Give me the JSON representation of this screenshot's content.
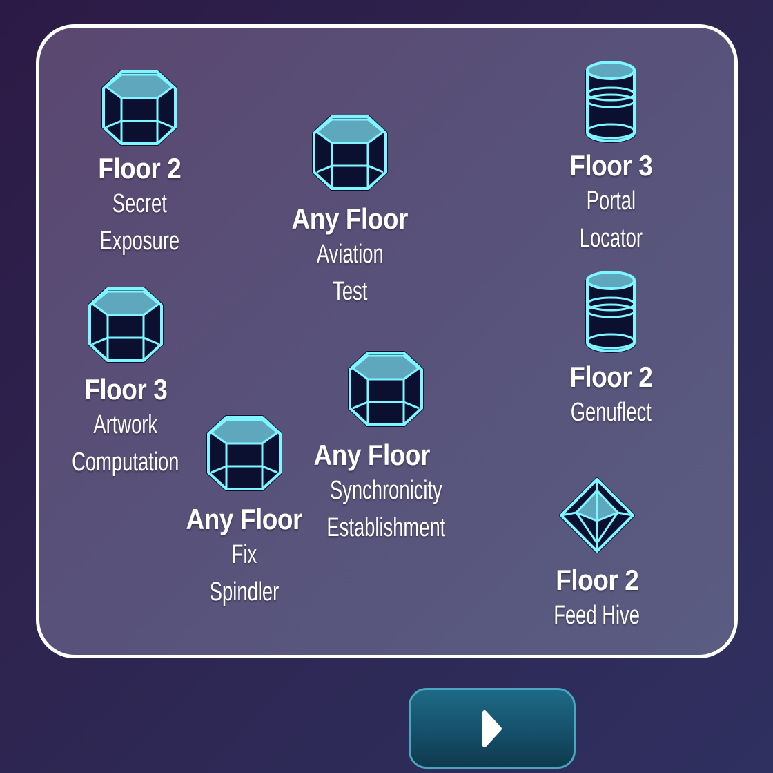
{
  "tasks": [
    {
      "floor": "Floor 2",
      "name": "Secret\nExposure",
      "icon": "hexagon-prism-icon"
    },
    {
      "floor": "Any Floor",
      "name": "Aviation\nTest",
      "icon": "hexagon-prism-icon"
    },
    {
      "floor": "Floor 3",
      "name": "Portal\nLocator",
      "icon": "cylinder-icon"
    },
    {
      "floor": "Floor 3",
      "name": "Artwork\nComputation",
      "icon": "hexagon-prism-icon"
    },
    {
      "floor": "Floor 2",
      "name": "Genuflect",
      "icon": "cylinder-icon"
    },
    {
      "floor": "Any Floor",
      "name": "Synchronicity\nEstablishment",
      "icon": "hexagon-prism-icon"
    },
    {
      "floor": "Any Floor",
      "name": "Fix Spindler",
      "icon": "hexagon-prism-icon"
    },
    {
      "floor": "Floor 2",
      "name": "Feed Hive",
      "icon": "octahedron-icon"
    }
  ],
  "next_button": {
    "icon": "play-arrow-icon"
  },
  "colors": {
    "icon_fill": "#5ea7bd",
    "icon_stroke": "#7ff6ff",
    "icon_outline": "#0b1030",
    "panel_border": "#ffffff"
  }
}
